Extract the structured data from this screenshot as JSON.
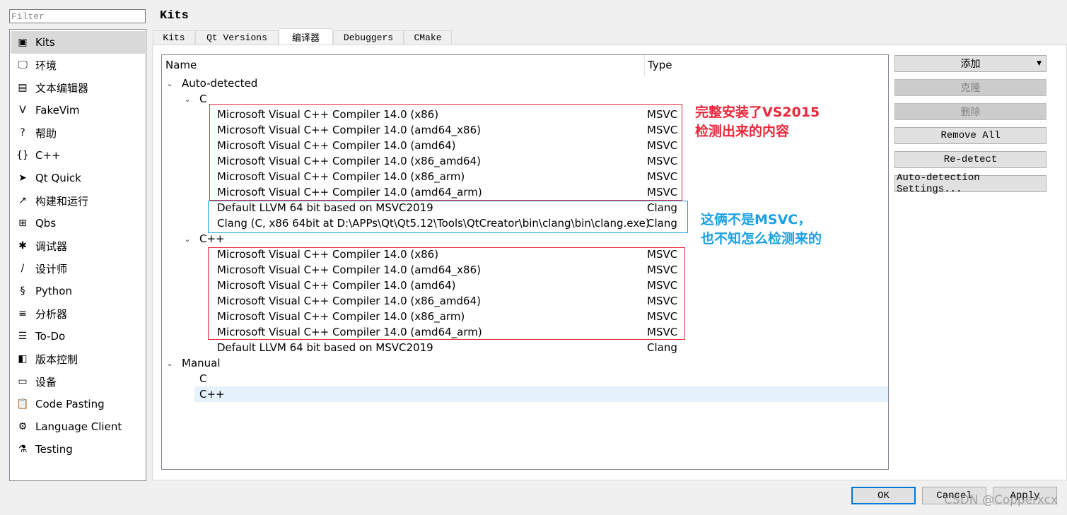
{
  "filter": {
    "placeholder": "Filter",
    "value": ""
  },
  "sidebar": {
    "items": [
      {
        "label": "Kits",
        "icon": "kits-icon",
        "glyph": "▣",
        "selected": true
      },
      {
        "label": "环境",
        "icon": "monitor-icon",
        "glyph": "🖵"
      },
      {
        "label": "文本编辑器",
        "icon": "text-editor-icon",
        "glyph": "▤"
      },
      {
        "label": "FakeVim",
        "icon": "fakevim-icon",
        "glyph": "V"
      },
      {
        "label": "帮助",
        "icon": "help-icon",
        "glyph": "?"
      },
      {
        "label": "C++",
        "icon": "braces-icon",
        "glyph": "{}"
      },
      {
        "label": "Qt Quick",
        "icon": "qtquick-icon",
        "glyph": "➤"
      },
      {
        "label": "构建和运行",
        "icon": "hammer-icon",
        "glyph": "↗"
      },
      {
        "label": "Qbs",
        "icon": "qbs-grid-icon",
        "glyph": "⊞"
      },
      {
        "label": "调试器",
        "icon": "bug-icon",
        "glyph": "✱"
      },
      {
        "label": "设计师",
        "icon": "pencil-icon",
        "glyph": "/"
      },
      {
        "label": "Python",
        "icon": "python-icon",
        "glyph": "§"
      },
      {
        "label": "分析器",
        "icon": "analyzer-icon",
        "glyph": "≡"
      },
      {
        "label": "To-Do",
        "icon": "todo-list-icon",
        "glyph": "☰"
      },
      {
        "label": "版本控制",
        "icon": "version-control-icon",
        "glyph": "◧"
      },
      {
        "label": "设备",
        "icon": "device-icon",
        "glyph": "▭"
      },
      {
        "label": "Code Pasting",
        "icon": "clipboard-icon",
        "glyph": "📋"
      },
      {
        "label": "Language Client",
        "icon": "language-client-icon",
        "glyph": "⚙"
      },
      {
        "label": "Testing",
        "icon": "flask-icon",
        "glyph": "⚗"
      }
    ]
  },
  "page": {
    "title": "Kits"
  },
  "tabs": [
    {
      "label": "Kits"
    },
    {
      "label": "Qt Versions"
    },
    {
      "label": "编译器",
      "active": true
    },
    {
      "label": "Debuggers"
    },
    {
      "label": "CMake"
    }
  ],
  "tree": {
    "columns": {
      "name": "Name",
      "type": "Type"
    },
    "auto_detected": {
      "label": "Auto-detected",
      "c": {
        "label": "C",
        "items": [
          {
            "name": "Microsoft Visual C++ Compiler 14.0 (x86)",
            "type": "MSVC"
          },
          {
            "name": "Microsoft Visual C++ Compiler 14.0 (amd64_x86)",
            "type": "MSVC"
          },
          {
            "name": "Microsoft Visual C++ Compiler 14.0 (amd64)",
            "type": "MSVC"
          },
          {
            "name": "Microsoft Visual C++ Compiler 14.0 (x86_amd64)",
            "type": "MSVC"
          },
          {
            "name": "Microsoft Visual C++ Compiler 14.0 (x86_arm)",
            "type": "MSVC"
          },
          {
            "name": "Microsoft Visual C++ Compiler 14.0 (amd64_arm)",
            "type": "MSVC"
          },
          {
            "name": "Default LLVM 64 bit based on MSVC2019",
            "type": "Clang"
          },
          {
            "name": "Clang (C, x86 64bit at D:\\APPs\\Qt\\Qt5.12\\Tools\\QtCreator\\bin\\clang\\bin\\clang.exe)",
            "type": "Clang"
          }
        ]
      },
      "cpp": {
        "label": "C++",
        "items": [
          {
            "name": "Microsoft Visual C++ Compiler 14.0 (x86)",
            "type": "MSVC"
          },
          {
            "name": "Microsoft Visual C++ Compiler 14.0 (amd64_x86)",
            "type": "MSVC"
          },
          {
            "name": "Microsoft Visual C++ Compiler 14.0 (amd64)",
            "type": "MSVC"
          },
          {
            "name": "Microsoft Visual C++ Compiler 14.0 (x86_amd64)",
            "type": "MSVC"
          },
          {
            "name": "Microsoft Visual C++ Compiler 14.0 (x86_arm)",
            "type": "MSVC"
          },
          {
            "name": "Microsoft Visual C++ Compiler 14.0 (amd64_arm)",
            "type": "MSVC"
          },
          {
            "name": "Default LLVM 64 bit based on MSVC2019",
            "type": "Clang"
          }
        ]
      }
    },
    "manual": {
      "label": "Manual",
      "c": "C",
      "cpp": "C++"
    }
  },
  "annotations": {
    "red_note": [
      "完整安装了VS2015",
      "检测出来的内容"
    ],
    "blue_note": [
      "这俩不是MSVC，",
      "也不知怎么检测来的"
    ],
    "colors": {
      "red": "#e8283b",
      "blue": "#1ba1e2"
    }
  },
  "buttons": {
    "add": "添加",
    "clone": "克隆",
    "remove": "删除",
    "remove_all": "Remove All",
    "redetect": "Re-detect",
    "auto_detection_settings": "Auto-detection Settings..."
  },
  "dialog": {
    "ok": "OK",
    "cancel": "Cancel",
    "apply": "Apply"
  },
  "watermark": "CSDN @Copperxcx",
  "colors": {
    "selection": "#e5f1fb",
    "sidebar_selected": "#d9d9d9",
    "default_button_border": "#0078d7"
  }
}
